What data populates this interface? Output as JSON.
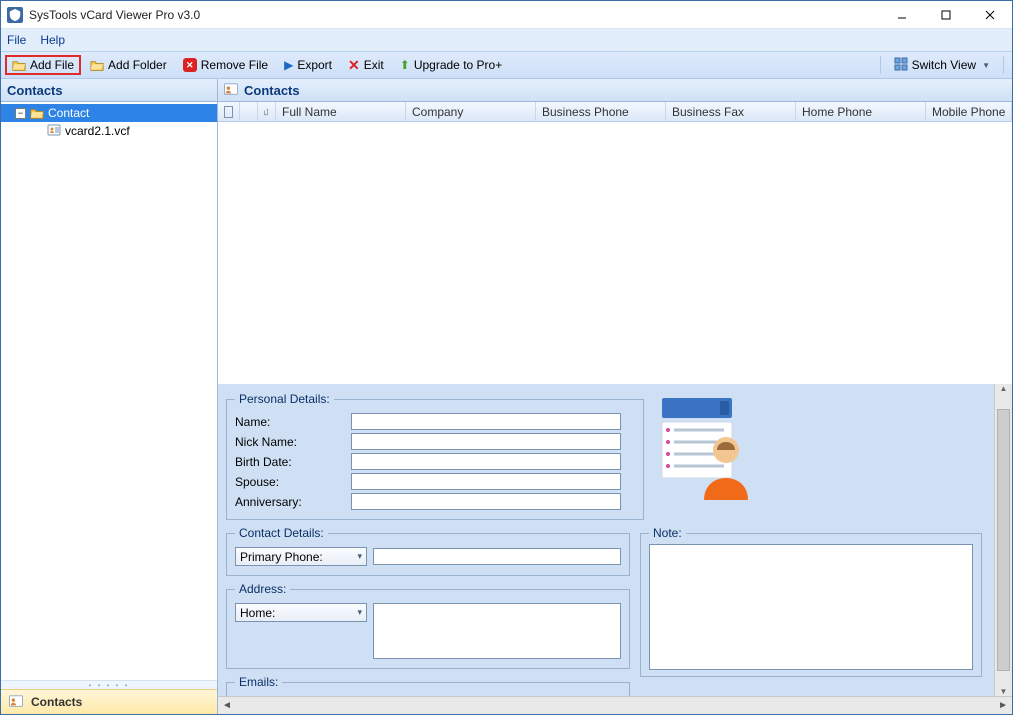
{
  "title": "SysTools vCard Viewer Pro v3.0",
  "menu": {
    "file": "File",
    "help": "Help"
  },
  "toolbar": {
    "add_file": "Add File",
    "add_folder": "Add Folder",
    "remove_file": "Remove File",
    "export": "Export",
    "exit": "Exit",
    "upgrade": "Upgrade to Pro+",
    "switch_view": "Switch View"
  },
  "left": {
    "header": "Contacts",
    "root": "Contact",
    "file": "vcard2.1.vcf",
    "nav_button": "Contacts"
  },
  "right": {
    "header": "Contacts",
    "columns": {
      "full_name": "Full Name",
      "company": "Company",
      "business_phone": "Business Phone",
      "business_fax": "Business Fax",
      "home_phone": "Home Phone",
      "mobile_phone": "Mobile Phone"
    }
  },
  "details": {
    "personal_legend": "Personal Details:",
    "name": "Name:",
    "nick": "Nick Name:",
    "birth": "Birth Date:",
    "spouse": "Spouse:",
    "anniversary": "Anniversary:",
    "contact_legend": "Contact Details:",
    "primary_phone": "Primary Phone:",
    "address_legend": "Address:",
    "home": "Home:",
    "note_legend": "Note:",
    "emails_legend": "Emails:"
  }
}
